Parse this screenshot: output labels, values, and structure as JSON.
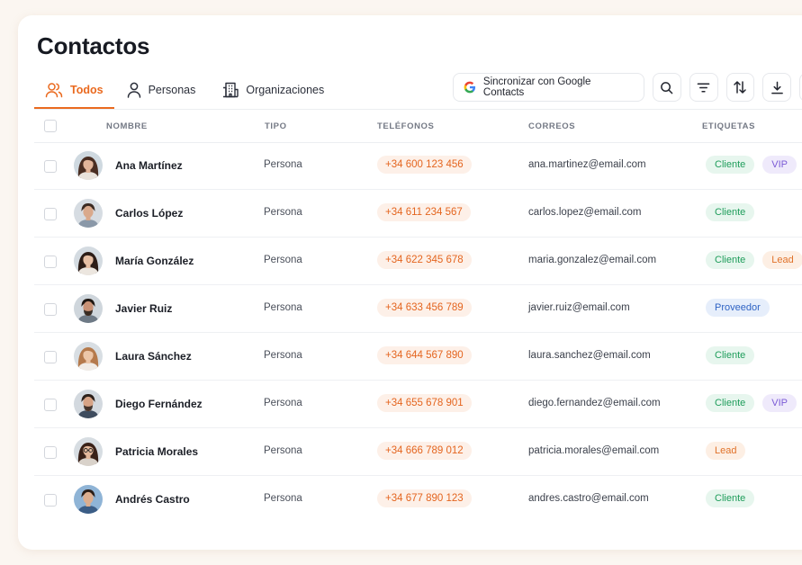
{
  "page": {
    "title": "Contactos"
  },
  "tabs": [
    {
      "label": "Todos",
      "icon": "users-icon",
      "active": true
    },
    {
      "label": "Personas",
      "icon": "user-icon",
      "active": false
    },
    {
      "label": "Organizaciones",
      "icon": "building-icon",
      "active": false
    }
  ],
  "toolbar": {
    "sync_label": "Sincronizar con Google Contacts",
    "sync_icon": "google-icon",
    "icons": [
      "search-icon",
      "filter-icon",
      "sort-icon",
      "download-icon"
    ]
  },
  "columns": {
    "nombre": "NOMBRE",
    "tipo": "TIPO",
    "telefonos": "TELÉFONOS",
    "correos": "CORREOS",
    "etiquetas": "ETIQUETAS"
  },
  "colors": {
    "accent": "#ea6a1f",
    "tag_cliente": "#1f9d5b",
    "tag_vip": "#7b5bd6",
    "tag_lead": "#e0722a",
    "tag_proveedor": "#2f63c4"
  },
  "contacts": [
    {
      "name": "Ana Martínez",
      "tipo": "Persona",
      "phone": "+34 600 123 456",
      "email": "ana.martinez@email.com",
      "tags": [
        "Cliente",
        "VIP"
      ]
    },
    {
      "name": "Carlos López",
      "tipo": "Persona",
      "phone": "+34 611 234 567",
      "email": "carlos.lopez@email.com",
      "tags": [
        "Cliente"
      ]
    },
    {
      "name": "María González",
      "tipo": "Persona",
      "phone": "+34 622 345 678",
      "email": "maria.gonzalez@email.com",
      "tags": [
        "Cliente",
        "Lead"
      ]
    },
    {
      "name": "Javier Ruiz",
      "tipo": "Persona",
      "phone": "+34 633 456 789",
      "email": "javier.ruiz@email.com",
      "tags": [
        "Proveedor"
      ]
    },
    {
      "name": "Laura Sánchez",
      "tipo": "Persona",
      "phone": "+34 644 567 890",
      "email": "laura.sanchez@email.com",
      "tags": [
        "Cliente"
      ]
    },
    {
      "name": "Diego Fernández",
      "tipo": "Persona",
      "phone": "+34 655 678 901",
      "email": "diego.fernandez@email.com",
      "tags": [
        "Cliente",
        "VIP"
      ]
    },
    {
      "name": "Patricia Morales",
      "tipo": "Persona",
      "phone": "+34 666 789 012",
      "email": "patricia.morales@email.com",
      "tags": [
        "Lead"
      ]
    },
    {
      "name": "Andrés Castro",
      "tipo": "Persona",
      "phone": "+34 677 890 123",
      "email": "andres.castro@email.com",
      "tags": [
        "Cliente"
      ]
    }
  ]
}
